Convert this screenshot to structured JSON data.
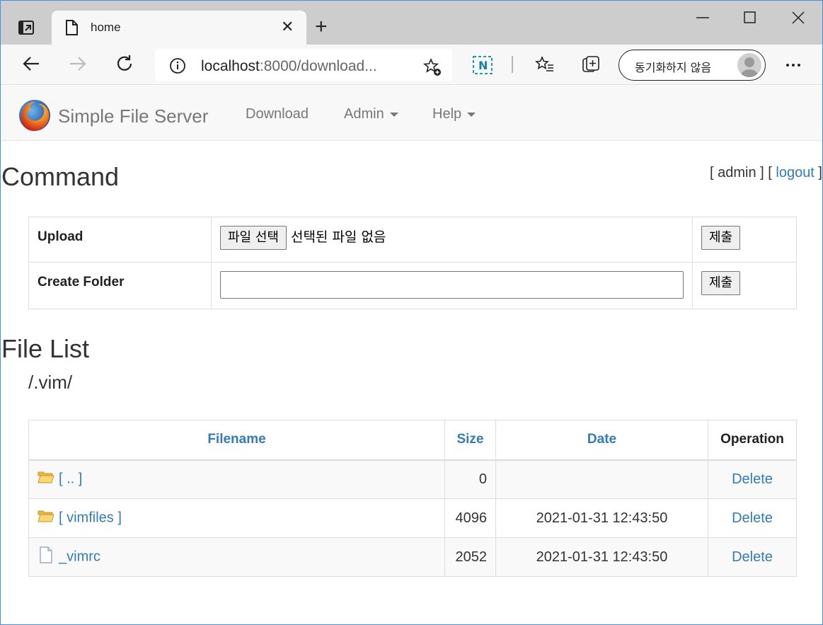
{
  "browser": {
    "tab": {
      "title": "home"
    },
    "address": {
      "url_host": "localhost",
      "url_rest": ":8000/download..."
    },
    "sync": {
      "label": "동기화하지 않음"
    }
  },
  "navbar": {
    "brand": "Simple File Server",
    "links": [
      {
        "label": "Download",
        "dropdown": false
      },
      {
        "label": "Admin",
        "dropdown": true
      },
      {
        "label": "Help",
        "dropdown": true
      }
    ]
  },
  "command": {
    "heading": "Command",
    "auth": {
      "open1": "[ ",
      "user": "admin",
      "close1": " ] [ ",
      "logout": "logout",
      "close2": " ]"
    },
    "rows": [
      {
        "label": "Upload",
        "choose_button": "파일 선택",
        "file_status": "선택된 파일 없음",
        "submit": "제출"
      },
      {
        "label": "Create Folder",
        "input_value": "",
        "submit": "제출"
      }
    ]
  },
  "file_list": {
    "heading": "File List",
    "path": "/.vim/",
    "columns": [
      "Filename",
      "Size",
      "Date",
      "Operation"
    ],
    "rows": [
      {
        "icon": "folder-icon",
        "name": "[ .. ]",
        "size": "0",
        "date": "",
        "operation": "Delete"
      },
      {
        "icon": "folder-icon",
        "name": "[ vimfiles ]",
        "size": "4096",
        "date": "2021-01-31 12:43:50",
        "operation": "Delete"
      },
      {
        "icon": "file-icon",
        "name": "_vimrc",
        "size": "2052",
        "date": "2021-01-31 12:43:50",
        "operation": "Delete"
      }
    ]
  },
  "colors": {
    "link": "#337ab7",
    "navbar_bg": "#f8f8f8",
    "tabbar_bg": "#cdcdcd"
  }
}
